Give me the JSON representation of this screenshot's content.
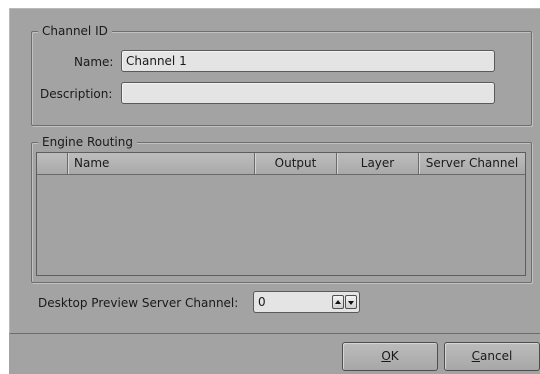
{
  "channel_id": {
    "legend": "Channel ID",
    "name_label": "Name:",
    "name_value": "Channel 1",
    "description_label": "Description:",
    "description_value": ""
  },
  "engine_routing": {
    "legend": "Engine Routing",
    "columns": [
      "",
      "Name",
      "Output",
      "Layer",
      "Server Channel"
    ],
    "rows": []
  },
  "preview": {
    "label": "Desktop Preview Server Channel:",
    "value": "0",
    "up_icon": "spin-up-icon",
    "down_icon": "spin-down-icon"
  },
  "buttons": {
    "ok_mnemonic": "O",
    "ok_rest": "K",
    "cancel_mnemonic": "C",
    "cancel_rest": "ancel"
  },
  "colors": {
    "dialog_bg": "#a3a3a3",
    "field_bg": "#e4e4e4"
  }
}
